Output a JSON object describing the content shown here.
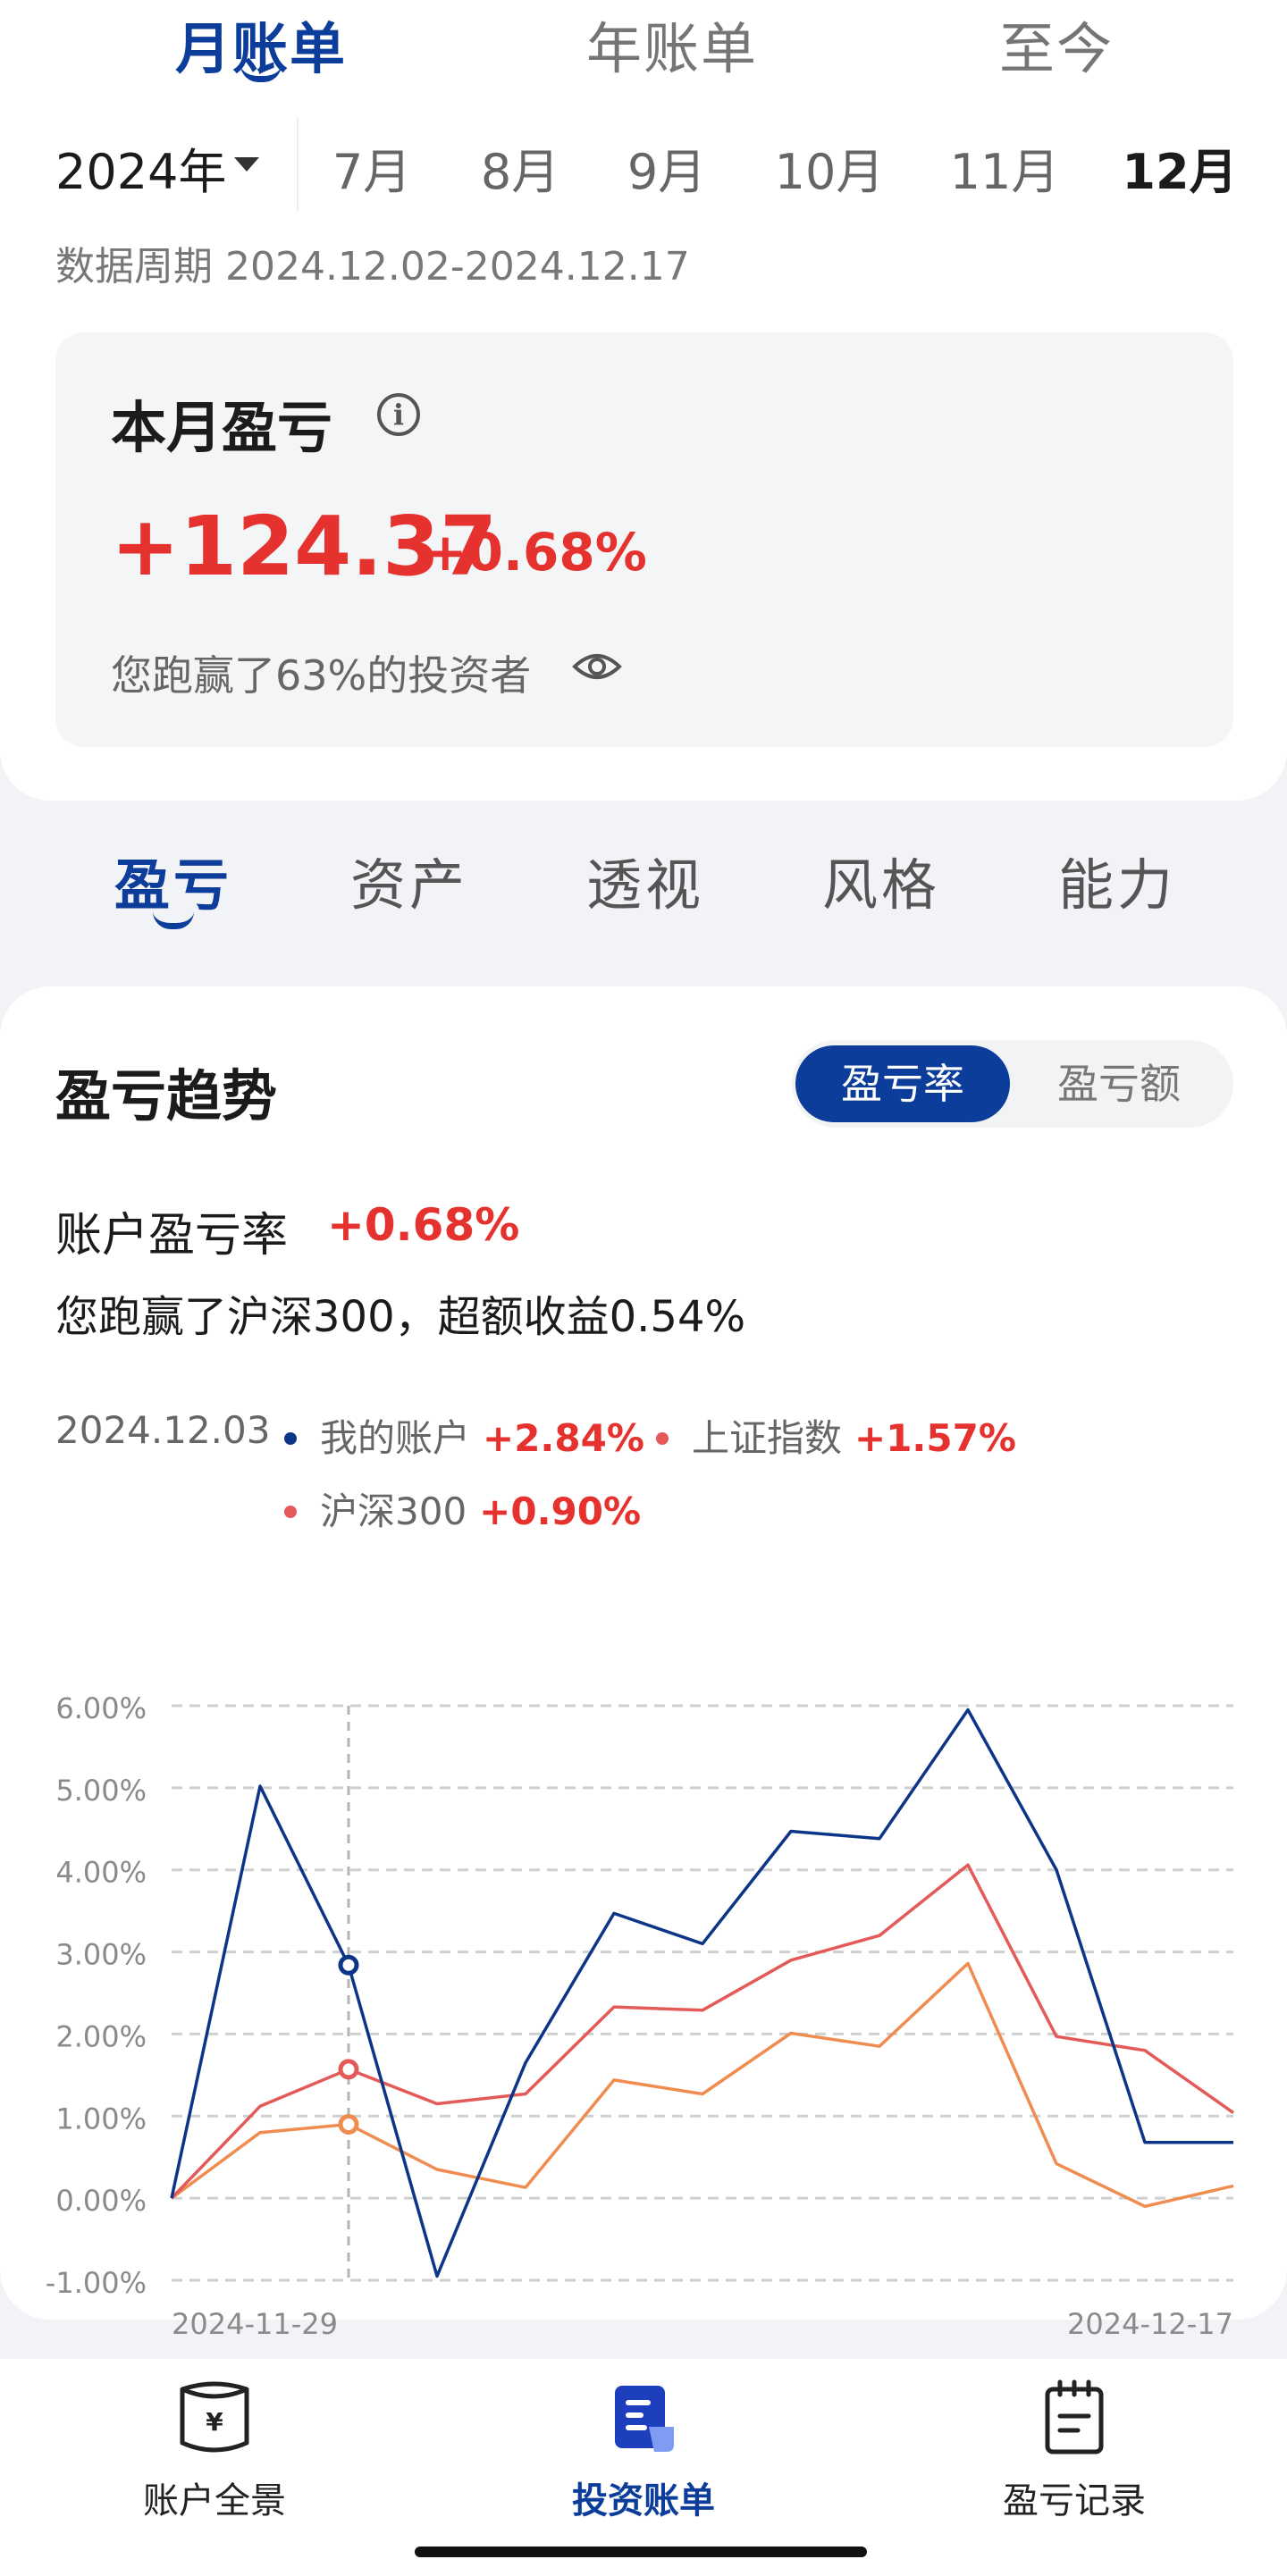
{
  "main_tabs": [
    {
      "label": "月账单",
      "active": true
    },
    {
      "label": "年账单",
      "active": false
    },
    {
      "label": "至今",
      "active": false
    }
  ],
  "year_select": "2024年",
  "months": [
    "7月",
    "8月",
    "9月",
    "10月",
    "11月",
    "12月"
  ],
  "selected_month": "12月",
  "period_text": "数据周期 2024.12.02-2024.12.17",
  "pnl_card": {
    "title": "本月盈亏",
    "amount": "+124.37",
    "percent": "+0.68%",
    "beat_text": "您跑赢了63%的投资者"
  },
  "section_tabs": [
    {
      "label": "盈亏",
      "active": true
    },
    {
      "label": "资产",
      "active": false
    },
    {
      "label": "透视",
      "active": false
    },
    {
      "label": "风格",
      "active": false
    },
    {
      "label": "能力",
      "active": false
    }
  ],
  "trend": {
    "title": "盈亏趋势",
    "toggle": {
      "active": "盈亏率",
      "inactive": "盈亏额"
    },
    "account_rate_label": "账户盈亏率",
    "account_rate_value": "+0.68%",
    "excess_text": "您跑赢了沪深300，超额收益0.54%",
    "legend": {
      "date": "2024.12.03",
      "items": [
        {
          "name": "我的账户",
          "value": "+2.84%",
          "color": "#0c3587"
        },
        {
          "name": "上证指数",
          "value": "+1.57%",
          "color": "#e35a58"
        },
        {
          "name": "沪深300",
          "value": "+0.90%",
          "color": "#e35a58"
        }
      ]
    }
  },
  "chart_data": {
    "type": "line",
    "x_start_label": "2024-11-29",
    "x_end_label": "2024-12-17",
    "y_ticks": [
      "6.00%",
      "5.00%",
      "4.00%",
      "3.00%",
      "2.00%",
      "1.00%",
      "0.00%",
      "-1.00%"
    ],
    "ylim": [
      -1,
      6
    ],
    "highlight_index": 2,
    "series": [
      {
        "name": "我的账户",
        "color": "#0c3587",
        "values": [
          0,
          5.02,
          2.84,
          -0.95,
          1.65,
          3.47,
          3.1,
          4.47,
          4.38,
          5.95,
          4.0,
          0.68,
          0.68
        ]
      },
      {
        "name": "上证指数",
        "color": "#e35a58",
        "values": [
          0,
          1.12,
          1.57,
          1.15,
          1.27,
          2.33,
          2.29,
          2.9,
          3.2,
          4.06,
          1.97,
          1.8,
          1.04
        ]
      },
      {
        "name": "沪深300",
        "color": "#f08c50",
        "values": [
          0,
          0.8,
          0.9,
          0.35,
          0.13,
          1.44,
          1.27,
          2.01,
          1.85,
          2.86,
          0.42,
          -0.1,
          0.15
        ]
      }
    ]
  },
  "bottom_nav": [
    {
      "label": "账户全景",
      "active": false,
      "icon": "wallet-yuan-icon"
    },
    {
      "label": "投资账单",
      "active": true,
      "icon": "bill-document-icon"
    },
    {
      "label": "盈亏记录",
      "active": false,
      "icon": "record-notepad-icon"
    }
  ],
  "colors": {
    "brand": "#0c3d9a",
    "positive": "#e5322f",
    "account_line": "#0c3587",
    "sh_index_line": "#e35a58",
    "csi300_line": "#f08c50"
  }
}
